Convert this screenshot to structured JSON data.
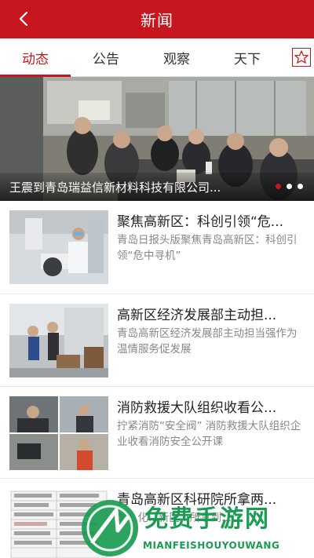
{
  "header": {
    "title": "新闻",
    "back_icon": "chevron-left-icon"
  },
  "tabs": [
    {
      "label": "动态",
      "active": true
    },
    {
      "label": "公告",
      "active": false
    },
    {
      "label": "观察",
      "active": false
    },
    {
      "label": "天下",
      "active": false
    }
  ],
  "tab_star_icon": "star-outline-icon",
  "banner": {
    "caption": "王震到青岛瑞益信新材料科技有限公司...",
    "slide_count": 3,
    "active_slide": 1
  },
  "news": [
    {
      "title": "聚焦高新区：科创引领“危...",
      "desc": "青岛日报头版聚焦青岛高新区：科创引领“危中寻机”"
    },
    {
      "title": "高新区经济发展部主动担...",
      "desc": "青岛高新区经济发展部主动担当强作为 温情服务促发展"
    },
    {
      "title": "消防救援大队组织收看公...",
      "desc": "拧紧消防“安全阀” 消防救援大队组织企业收看消防安全公开课"
    },
    {
      "title": "青岛高新区科研院所拿两...",
      "desc": "国...化...新区...所拿到..."
    }
  ],
  "watermark": {
    "text": "免费手游网",
    "subtext": "MIANFEISHOUYOUWANG"
  },
  "colors": {
    "brand": "#c8161e",
    "text": "#222222",
    "muted": "#888888"
  }
}
